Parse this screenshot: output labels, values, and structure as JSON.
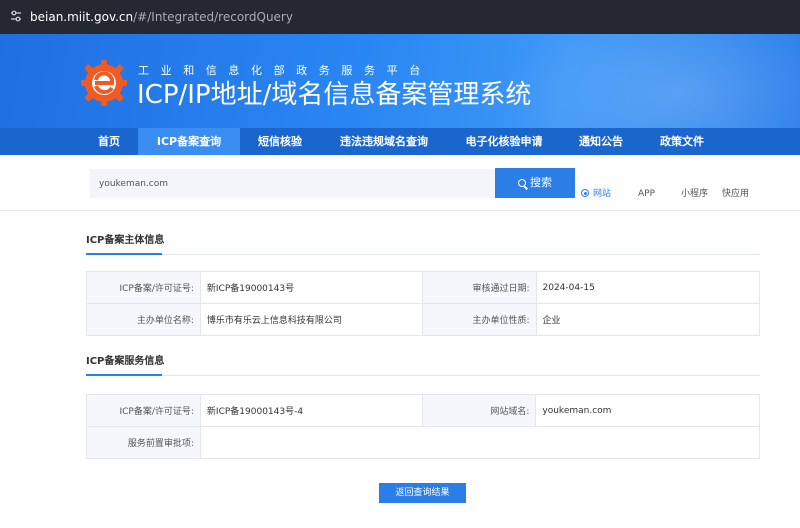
{
  "browser": {
    "address_host": "beian.miit.gov.cn",
    "address_path": "/#/Integrated/recordQuery"
  },
  "header": {
    "subtitle": "工业和信息化部政务服务平台",
    "title": "ICP/IP地址/域名信息备案管理系统"
  },
  "nav": {
    "items": [
      {
        "label": "首页",
        "active": false
      },
      {
        "label": "ICP备案查询",
        "active": true
      },
      {
        "label": "短信核验",
        "active": false
      },
      {
        "label": "违法违规域名查询",
        "active": false
      },
      {
        "label": "电子化核验申请",
        "active": false
      },
      {
        "label": "通知公告",
        "active": false
      },
      {
        "label": "政策文件",
        "active": false
      }
    ]
  },
  "search": {
    "value": "youkeman.com",
    "button_label": "搜索",
    "types": [
      {
        "label": "网站",
        "checked": true
      },
      {
        "label": "APP",
        "checked": false
      },
      {
        "label": "小程序",
        "checked": false
      },
      {
        "label": "快应用",
        "checked": false
      }
    ]
  },
  "subject_info": {
    "title": "ICP备案主体信息",
    "rows": [
      {
        "label1": "ICP备案/许可证号:",
        "value1": "新ICP备19000143号",
        "label2": "审核通过日期:",
        "value2": "2024-04-15"
      },
      {
        "label1": "主办单位名称:",
        "value1": "博乐市有乐云上信息科技有限公司",
        "label2": "主办单位性质:",
        "value2": "企业"
      }
    ]
  },
  "service_info": {
    "title": "ICP备案服务信息",
    "rows": [
      {
        "label1": "ICP备案/许可证号:",
        "value1": "新ICP备19000143号-4",
        "label2": "网站域名:",
        "value2": "youkeman.com"
      },
      {
        "label1": "服务前置审批项:",
        "value1": ""
      }
    ]
  },
  "actions": {
    "back_label": "返回查询结果"
  },
  "colors": {
    "accent": "#2b7ee6",
    "nav_bg": "#1a66cc",
    "nav_active": "#3b8ef0",
    "logo_orange": "#f15a22"
  }
}
